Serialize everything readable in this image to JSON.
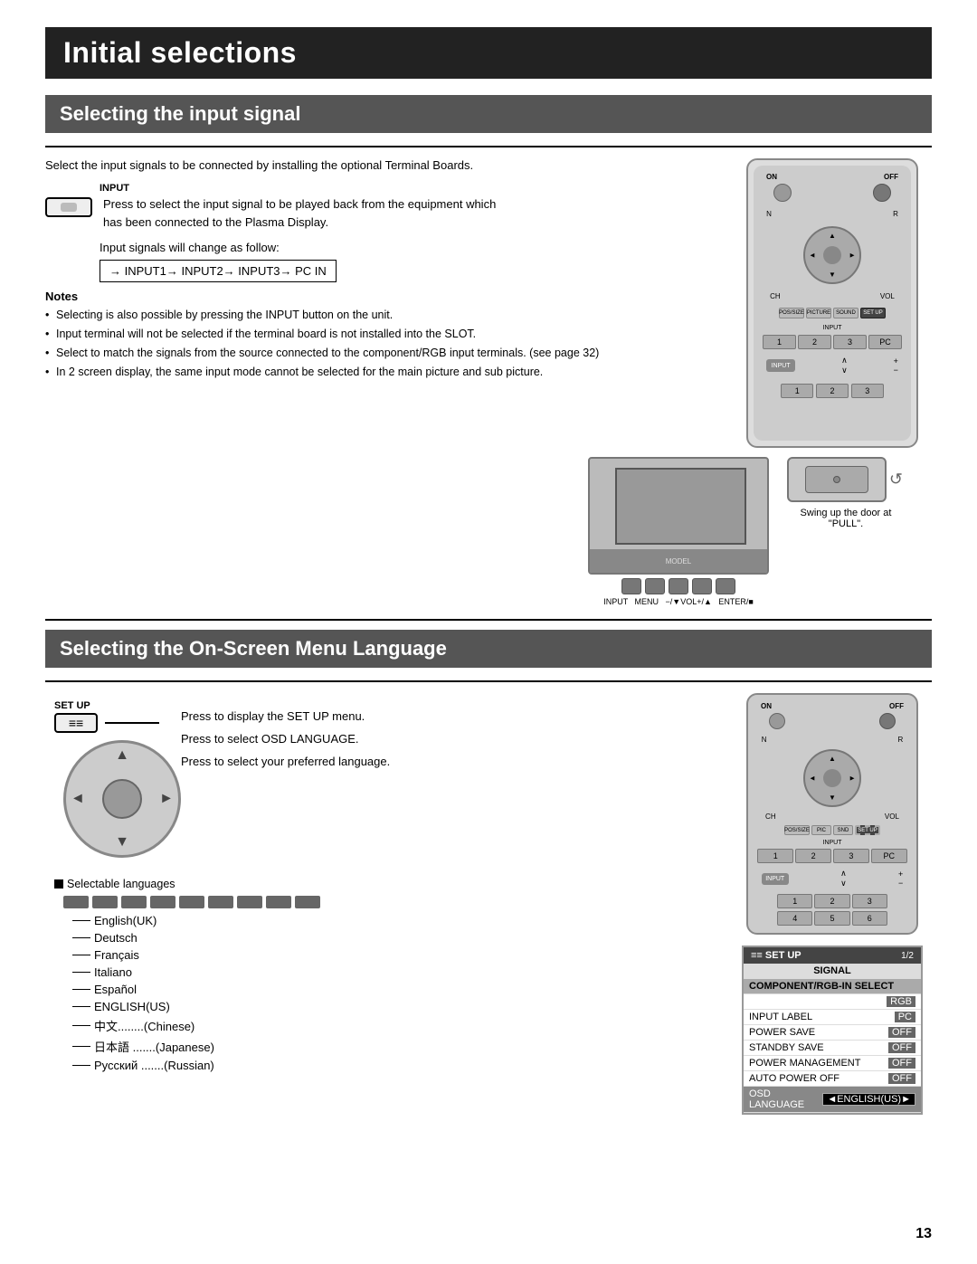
{
  "page": {
    "title": "Initial selections",
    "page_number": "13"
  },
  "section1": {
    "heading": "Selecting the input signal",
    "intro": "Select the input signals to be connected by installing the optional Terminal Boards.",
    "input_label": "INPUT",
    "input_desc_lines": [
      "Press to select the input signal to be played back from",
      "the equipment which has been connected to the Plasma",
      "Display."
    ],
    "signal_change_label": "Input signals will change as follow:",
    "signal_flow": "→ INPUT1→ INPUT2→ INPUT3→ PC IN",
    "notes_title": "Notes",
    "notes": [
      "Selecting is also possible by pressing the INPUT button on the unit.",
      "Input terminal will not be selected if the terminal board is not installed into the SLOT.",
      "Select to match the signals from the source connected to the component/RGB input terminals. (see page 32)",
      "In 2 screen display, the same input mode cannot be selected for the main picture and sub picture."
    ],
    "swing_text": "Swing up the door at \"PULL\"."
  },
  "section2": {
    "heading": "Selecting the On-Screen Menu Language",
    "setup_label": "SET UP",
    "instructions": [
      "Press to display the SET UP menu.",
      "Press to select OSD LANGUAGE.",
      "Press to select your preferred language."
    ],
    "selectable_label": "Selectable languages",
    "languages": [
      "English(UK)",
      "Deutsch",
      "Français",
      "Italiano",
      "Español",
      "ENGLISH(US)",
      "中文........(Chinese)",
      "日本語 .......(Japanese)",
      "Русский .......(Russian)"
    ],
    "menu": {
      "header": "≡≡ SET UP",
      "page": "1/2",
      "rows": [
        {
          "label": "SIGNAL",
          "value": "",
          "type": "section"
        },
        {
          "label": "COMPONENT/RGB-IN SELECT",
          "value": "",
          "type": "highlighted"
        },
        {
          "label": "",
          "value": "RGB",
          "type": "value-only"
        },
        {
          "label": "INPUT LABEL",
          "value": "PC",
          "type": "normal"
        },
        {
          "label": "POWER SAVE",
          "value": "OFF",
          "type": "normal"
        },
        {
          "label": "STANDBY SAVE",
          "value": "OFF",
          "type": "normal"
        },
        {
          "label": "POWER MANAGEMENT",
          "value": "OFF",
          "type": "normal"
        },
        {
          "label": "AUTO POWER OFF",
          "value": "OFF",
          "type": "normal"
        },
        {
          "label": "OSD LANGUAGE",
          "value": "◄ENGLISH(US)►",
          "type": "highlighted-value"
        }
      ]
    }
  }
}
